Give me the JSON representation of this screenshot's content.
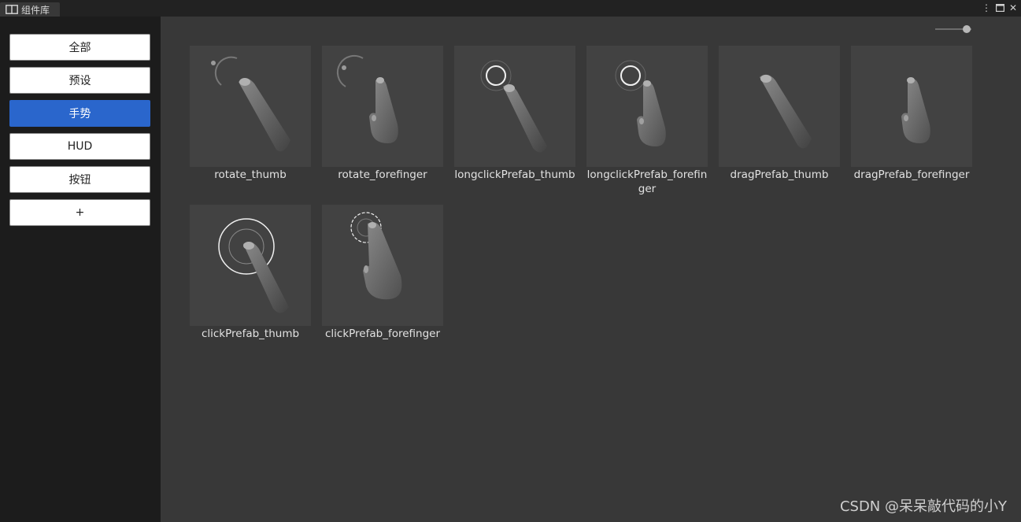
{
  "window": {
    "tab_title": "组件库",
    "controls": {
      "menu": "⋮",
      "maximize": "🗖",
      "close": "✕"
    }
  },
  "sidebar": {
    "items": [
      {
        "label": "全部",
        "active": false
      },
      {
        "label": "预设",
        "active": false
      },
      {
        "label": "手势",
        "active": true
      },
      {
        "label": "HUD",
        "active": false
      },
      {
        "label": "按钮",
        "active": false
      },
      {
        "label": "+",
        "active": false
      }
    ],
    "accent_color": "#2a66cc"
  },
  "main": {
    "zoom_slider": {
      "value": 0.87
    },
    "assets": [
      {
        "label": "rotate_thumb",
        "icon": "rotate-thumb-icon"
      },
      {
        "label": "rotate_forefinger",
        "icon": "rotate-forefinger-icon"
      },
      {
        "label": "longclickPrefab_thumb",
        "icon": "longclick-thumb-icon"
      },
      {
        "label": "longclickPrefab_forefinger",
        "icon": "longclick-forefinger-icon"
      },
      {
        "label": "dragPrefab_thumb",
        "icon": "drag-thumb-icon"
      },
      {
        "label": "dragPrefab_forefinger",
        "icon": "drag-forefinger-icon"
      },
      {
        "label": "clickPrefab_thumb",
        "icon": "click-thumb-icon"
      },
      {
        "label": "clickPrefab_forefinger",
        "icon": "click-forefinger-icon"
      }
    ]
  },
  "watermark": "CSDN @呆呆敲代码的小Y"
}
